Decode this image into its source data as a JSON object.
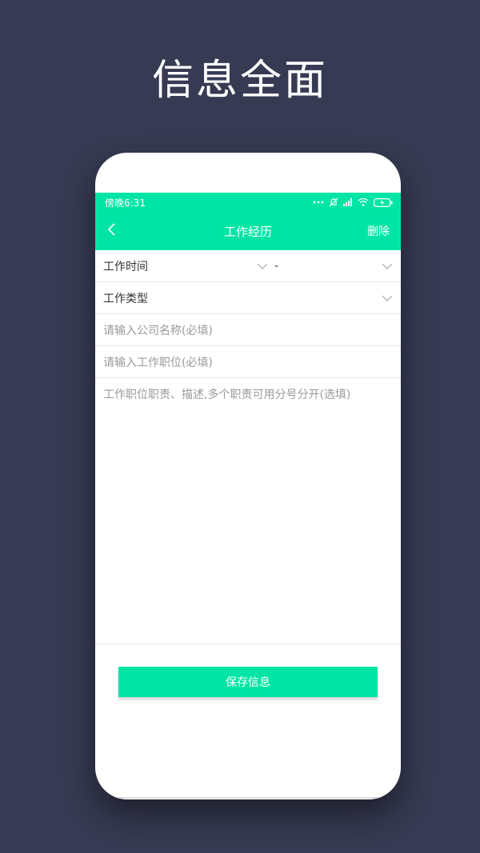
{
  "promo": {
    "title": "信息全面"
  },
  "status_bar": {
    "time": "傍晚6:31"
  },
  "nav": {
    "title": "工作经历",
    "delete_label": "删除"
  },
  "form": {
    "work_time_label": "工作时间",
    "work_time_separator": "-",
    "work_type_label": "工作类型",
    "company_placeholder": "请输入公司名称(必填)",
    "position_placeholder": "请输入工作职位(必填)",
    "description_placeholder": "工作职位职责、描述,多个职责可用分号分开(选填)"
  },
  "actions": {
    "save_label": "保存信息"
  },
  "colors": {
    "accent": "#00e5a5",
    "background": "#363a52"
  },
  "icons": [
    "back-arrow-icon",
    "chevron-down-icon",
    "signal-icon",
    "wifi-icon",
    "battery-icon",
    "mute-icon",
    "more-dots-icon"
  ]
}
